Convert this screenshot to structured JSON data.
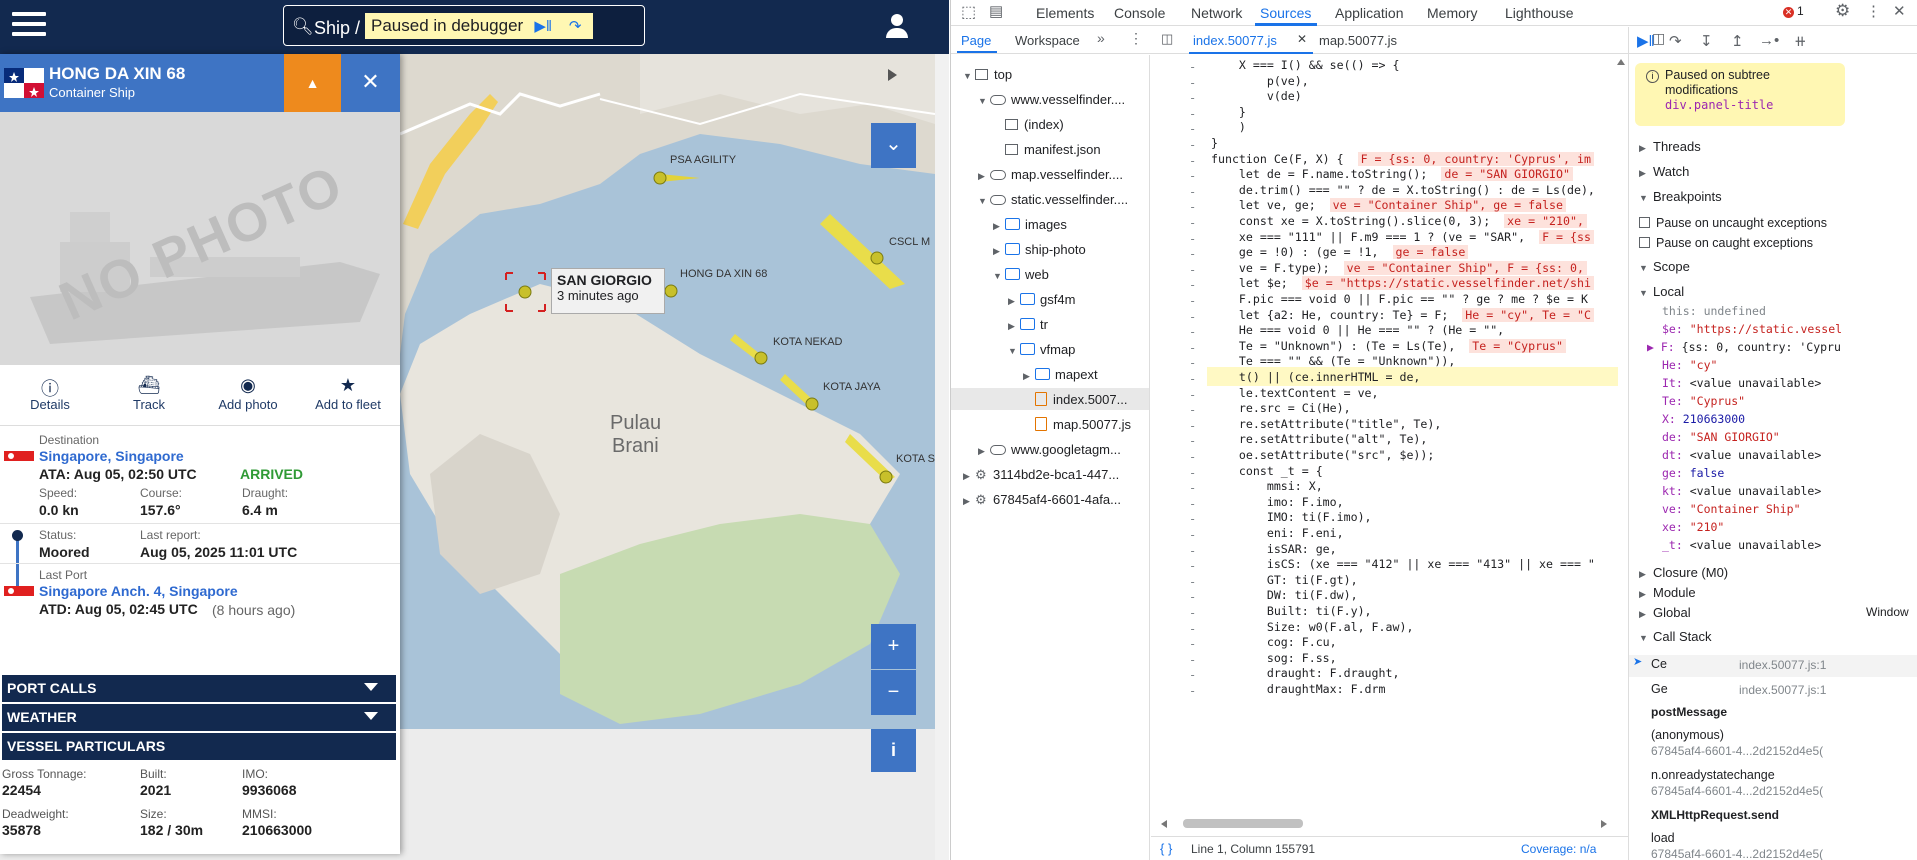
{
  "site": {
    "search_label": "Ship /",
    "debugger_text": "Paused in debugger",
    "vessel": {
      "name": "HONG DA XIN 68",
      "type": "Container Ship",
      "photo_text": "NO PHOTO",
      "actions": [
        {
          "label": "Details",
          "icon": "info-icon"
        },
        {
          "label": "Track",
          "icon": "ship-icon"
        },
        {
          "label": "Add photo",
          "icon": "camera-icon"
        },
        {
          "label": "Add to fleet",
          "icon": "star-icon"
        }
      ],
      "destination_label": "Destination",
      "destination": "Singapore, Singapore",
      "ata": "ATA: Aug 05, 02:50 UTC",
      "arrived": "ARRIVED",
      "speed_label": "Speed:",
      "speed": "0.0 kn",
      "course_label": "Course:",
      "course": "157.6°",
      "draught_label": "Draught:",
      "draught": "6.4 m",
      "status_label": "Status:",
      "status": "Moored",
      "last_report_label": "Last report:",
      "last_report": "Aug 05, 2025 11:01 UTC",
      "last_port_label": "Last Port",
      "last_port": "Singapore Anch. 4, Singapore",
      "atd": "ATD: Aug 05, 02:45 UTC",
      "atd_ago": "(8 hours ago)",
      "sections": [
        "PORT CALLS",
        "WEATHER",
        "VESSEL PARTICULARS"
      ],
      "particulars": {
        "gross_tonnage_label": "Gross Tonnage:",
        "gross_tonnage": "22454",
        "built_label": "Built:",
        "built": "2021",
        "imo_label": "IMO:",
        "imo": "9936068",
        "deadweight_label": "Deadweight:",
        "deadweight": "35878",
        "size_label": "Size:",
        "size": "182 / 30m",
        "mmsi_label": "MMSI:",
        "mmsi": "210663000"
      }
    },
    "map": {
      "popup_name": "SAN GIORGIO",
      "popup_time": "3 minutes ago",
      "labels": [
        "PSA AGILITY",
        "HONG DA XIN 68",
        "CSCL M",
        "KOTA NEKAD",
        "KOTA JAYA",
        "KOTA S",
        "Pulau",
        "Brani"
      ],
      "zoom_in": "+",
      "zoom_out": "−",
      "info": "i"
    }
  },
  "devtools": {
    "tabs": [
      "Elements",
      "Console",
      "Network",
      "Sources",
      "Application",
      "Memory",
      "Lighthouse"
    ],
    "active_tab": "Sources",
    "error_count": "1",
    "nav_tabs": [
      "Page",
      "Workspace"
    ],
    "file_tabs": [
      "index.50077.js",
      "map.50077.js"
    ],
    "tree": [
      {
        "label": "top",
        "kind": "page",
        "depth": 0,
        "arrow": "▼"
      },
      {
        "label": "www.vesselfinder....",
        "kind": "cloud",
        "depth": 1,
        "arrow": "▼"
      },
      {
        "label": "(index)",
        "kind": "page",
        "depth": 2,
        "arrow": ""
      },
      {
        "label": "manifest.json",
        "kind": "page",
        "depth": 2,
        "arrow": ""
      },
      {
        "label": "map.vesselfinder....",
        "kind": "cloud",
        "depth": 1,
        "arrow": "▶"
      },
      {
        "label": "static.vesselfinder....",
        "kind": "cloud",
        "depth": 1,
        "arrow": "▼"
      },
      {
        "label": "images",
        "kind": "folder",
        "depth": 2,
        "arrow": "▶"
      },
      {
        "label": "ship-photo",
        "kind": "folder",
        "depth": 2,
        "arrow": "▶"
      },
      {
        "label": "web",
        "kind": "folder",
        "depth": 2,
        "arrow": "▼"
      },
      {
        "label": "gsf4m",
        "kind": "folder",
        "depth": 3,
        "arrow": "▶"
      },
      {
        "label": "tr",
        "kind": "folder",
        "depth": 3,
        "arrow": "▶"
      },
      {
        "label": "vfmap",
        "kind": "folder",
        "depth": 3,
        "arrow": "▼"
      },
      {
        "label": "mapext",
        "kind": "folder",
        "depth": 4,
        "arrow": "▶"
      },
      {
        "label": "index.5007...",
        "kind": "js",
        "depth": 4,
        "arrow": ""
      },
      {
        "label": "map.50077.js",
        "kind": "js",
        "depth": 4,
        "arrow": ""
      },
      {
        "label": "www.googletagm...",
        "kind": "cloud",
        "depth": 1,
        "arrow": "▶"
      },
      {
        "label": "3114bd2e-bca1-447...",
        "kind": "gear",
        "depth": 0,
        "arrow": "▶"
      },
      {
        "label": "67845af4-6601-4afa...",
        "kind": "gear",
        "depth": 0,
        "arrow": "▶"
      }
    ],
    "code": [
      [
        "    X === I() && se(() => {",
        ""
      ],
      [
        "        p(ve),",
        ""
      ],
      [
        "        v(de)",
        ""
      ],
      [
        "    }",
        ""
      ],
      [
        "    )",
        ""
      ],
      [
        "}",
        ""
      ],
      [
        "function Ce(F, X) {",
        "F = {ss: 0, country: 'Cyprus', im"
      ],
      [
        "    let de = F.name.toString();",
        "de = \"SAN GIORGIO\""
      ],
      [
        "    de.trim() === \"\" ? de = X.toString() : de = Ls(de),",
        ""
      ],
      [
        "    let ve, ge;",
        "ve = \"Container Ship\", ge = false"
      ],
      [
        "    const xe = X.toString().slice(0, 3);",
        "xe = \"210\","
      ],
      [
        "    xe === \"111\" || F.m9 === 1 ? (ve = \"SAR\",",
        "F = {ss"
      ],
      [
        "    ge = !0) : (ge = !1,",
        "ge = false"
      ],
      [
        "    ve = F.type);",
        "ve = \"Container Ship\", F = {ss: 0,"
      ],
      [
        "    let $e;",
        "$e = \"https://static.vesselfinder.net/shi"
      ],
      [
        "    F.pic === void 0 || F.pic == \"\" ? ge ? me ? $e = K",
        ""
      ],
      [
        "    let {a2: He, country: Te} = F;",
        "He = \"cy\", Te = \"C"
      ],
      [
        "    He === void 0 || He === \"\" ? (He = \"\",",
        ""
      ],
      [
        "    Te = \"Unknown\") : (Te = Ls(Te),",
        "Te = \"Cyprus\""
      ],
      [
        "    Te === \"\" && (Te = \"Unknown\")),",
        ""
      ],
      [
        "    t() || (ce.innerHTML = de,",
        ""
      ],
      [
        "    le.textContent = ve,",
        ""
      ],
      [
        "    re.src = Ci(He),",
        ""
      ],
      [
        "    re.setAttribute(\"title\", Te),",
        ""
      ],
      [
        "    re.setAttribute(\"alt\", Te),",
        ""
      ],
      [
        "    oe.setAttribute(\"src\", $e));",
        ""
      ],
      [
        "    const _t = {",
        ""
      ],
      [
        "        mmsi: X,",
        ""
      ],
      [
        "        imo: F.imo,",
        ""
      ],
      [
        "        IMO: ti(F.imo),",
        ""
      ],
      [
        "        eni: F.eni,",
        ""
      ],
      [
        "        isSAR: ge,",
        ""
      ],
      [
        "        isCS: (xe === \"412\" || xe === \"413\" || xe === \"",
        ""
      ],
      [
        "        GT: ti(F.gt),",
        ""
      ],
      [
        "        DW: ti(F.dw),",
        ""
      ],
      [
        "        Built: ti(F.y),",
        ""
      ],
      [
        "        Size: w0(F.al, F.aw),",
        ""
      ],
      [
        "        cog: F.cu,",
        ""
      ],
      [
        "        sog: F.ss,",
        ""
      ],
      [
        "        draught: F.draught,",
        ""
      ],
      [
        "        draughtMax: F.drm",
        ""
      ]
    ],
    "status_position": "Line 1, Column 155791",
    "coverage": "Coverage: n/a",
    "paused_title": "Paused on subtree modifications",
    "paused_selector": "div.panel-title",
    "sections": {
      "threads": "Threads",
      "watch": "Watch",
      "breakpoints": "Breakpoints",
      "pause_uncaught": "Pause on uncaught exceptions",
      "pause_caught": "Pause on caught exceptions",
      "scope": "Scope",
      "local": "Local",
      "closure": "Closure (M0)",
      "module": "Module",
      "global": "Global",
      "global_val": "Window",
      "call_stack": "Call Stack"
    },
    "scope_vars": [
      {
        "k": "this:",
        "v": "undefined",
        "t": "u"
      },
      {
        "k": "$e:",
        "v": "\"https://static.vessel",
        "t": "s"
      },
      {
        "k": "▶ F:",
        "v": "{ss: 0, country: 'Cypru",
        "t": "p"
      },
      {
        "k": "He:",
        "v": "\"cy\"",
        "t": "s"
      },
      {
        "k": "It:",
        "v": "<value unavailable>",
        "t": "p"
      },
      {
        "k": "Te:",
        "v": "\"Cyprus\"",
        "t": "s"
      },
      {
        "k": "X:",
        "v": "210663000",
        "t": "n"
      },
      {
        "k": "de:",
        "v": "\"SAN GIORGIO\"",
        "t": "s"
      },
      {
        "k": "dt:",
        "v": "<value unavailable>",
        "t": "p"
      },
      {
        "k": "ge:",
        "v": "false",
        "t": "n"
      },
      {
        "k": "kt:",
        "v": "<value unavailable>",
        "t": "p"
      },
      {
        "k": "ve:",
        "v": "\"Container Ship\"",
        "t": "s"
      },
      {
        "k": "xe:",
        "v": "\"210\"",
        "t": "s"
      },
      {
        "k": "_t:",
        "v": "<value unavailable>",
        "t": "p"
      }
    ],
    "call_stack": [
      {
        "fn": "Ce",
        "loc": "index.50077.js:1"
      },
      {
        "fn": "Ge",
        "loc": "index.50077.js:1"
      },
      {
        "fn": "postMessage",
        "loc": ""
      },
      {
        "fn": "(anonymous)",
        "loc": "67845af4-6601-4...2d2152d4e5("
      },
      {
        "fn": "n.onreadystatechange",
        "loc": "67845af4-6601-4...2d2152d4e5("
      },
      {
        "fn": "XMLHttpRequest.send",
        "loc": ""
      },
      {
        "fn": "load",
        "loc": "67845af4-6601-4...2d2152d4e5("
      }
    ]
  }
}
